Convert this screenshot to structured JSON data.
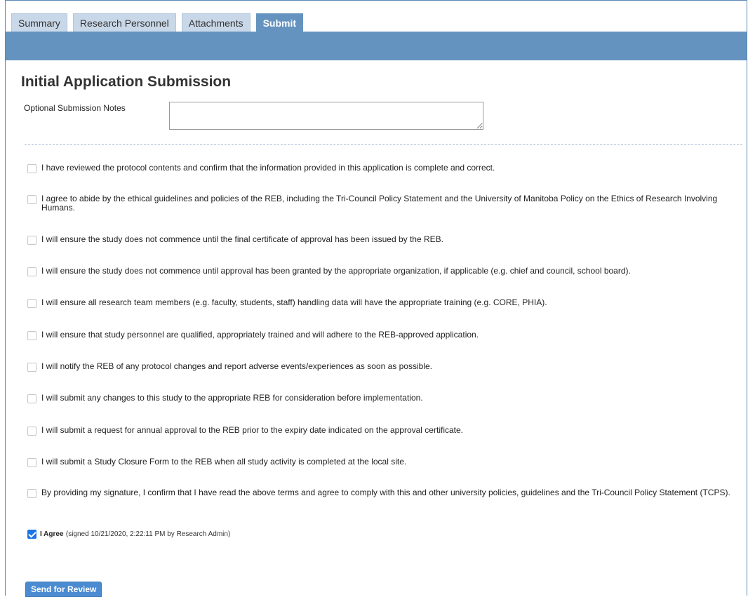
{
  "tabs": [
    {
      "label": "Summary",
      "active": false
    },
    {
      "label": "Research Personnel",
      "active": false
    },
    {
      "label": "Attachments",
      "active": false
    },
    {
      "label": "Submit",
      "active": true
    }
  ],
  "page": {
    "title": "Initial Application Submission",
    "notes_label": "Optional Submission Notes",
    "notes_value": ""
  },
  "statements": [
    {
      "text": "I have reviewed the protocol contents and confirm that the information provided in this application is complete and correct.",
      "checked": false
    },
    {
      "text": "I agree to abide by the ethical guidelines and policies of the REB, including the Tri-Council Policy Statement and the University of Manitoba Policy on the Ethics of Research Involving Humans.",
      "checked": false
    },
    {
      "text": "I will ensure the study does not commence until the final certificate of approval has been issued by the REB.",
      "checked": false
    },
    {
      "text": "I will ensure the study does not commence until approval has been granted by the appropriate organization, if applicable (e.g. chief and council, school board).",
      "checked": false
    },
    {
      "text": "I will ensure all research team members (e.g. faculty, students, staff) handling data will have the appropriate training (e.g. CORE, PHIA).",
      "checked": false
    },
    {
      "text": "I will ensure that study personnel are qualified, appropriately trained and will adhere to the REB-approved application.",
      "checked": false
    },
    {
      "text": "I will notify the REB of any protocol changes and report adverse events/experiences as soon as possible.",
      "checked": false
    },
    {
      "text": "I will submit any changes to this study to the appropriate REB for consideration before implementation.",
      "checked": false
    },
    {
      "text": "I will submit a request for annual approval to the REB prior to the expiry date indicated on the approval certificate.",
      "checked": false
    },
    {
      "text": "I will submit a Study Closure Form to the REB when all study activity is completed at the local site.",
      "checked": false
    },
    {
      "text": "By providing my signature, I confirm that I have read the above terms and agree to comply with this and other university policies, guidelines and the Tri-Council Policy Statement (TCPS).",
      "checked": false
    }
  ],
  "agree": {
    "label": "I Agree",
    "note": "(signed 10/21/2020, 2:22:11 PM by Research Admin)",
    "checked": true
  },
  "send_button_label": "Send for Review",
  "colors": {
    "tab_active": "#6593bf",
    "tab": "#c9d8e8",
    "button": "#4a8bd1",
    "checkbox_checked": "#1a73e8"
  }
}
